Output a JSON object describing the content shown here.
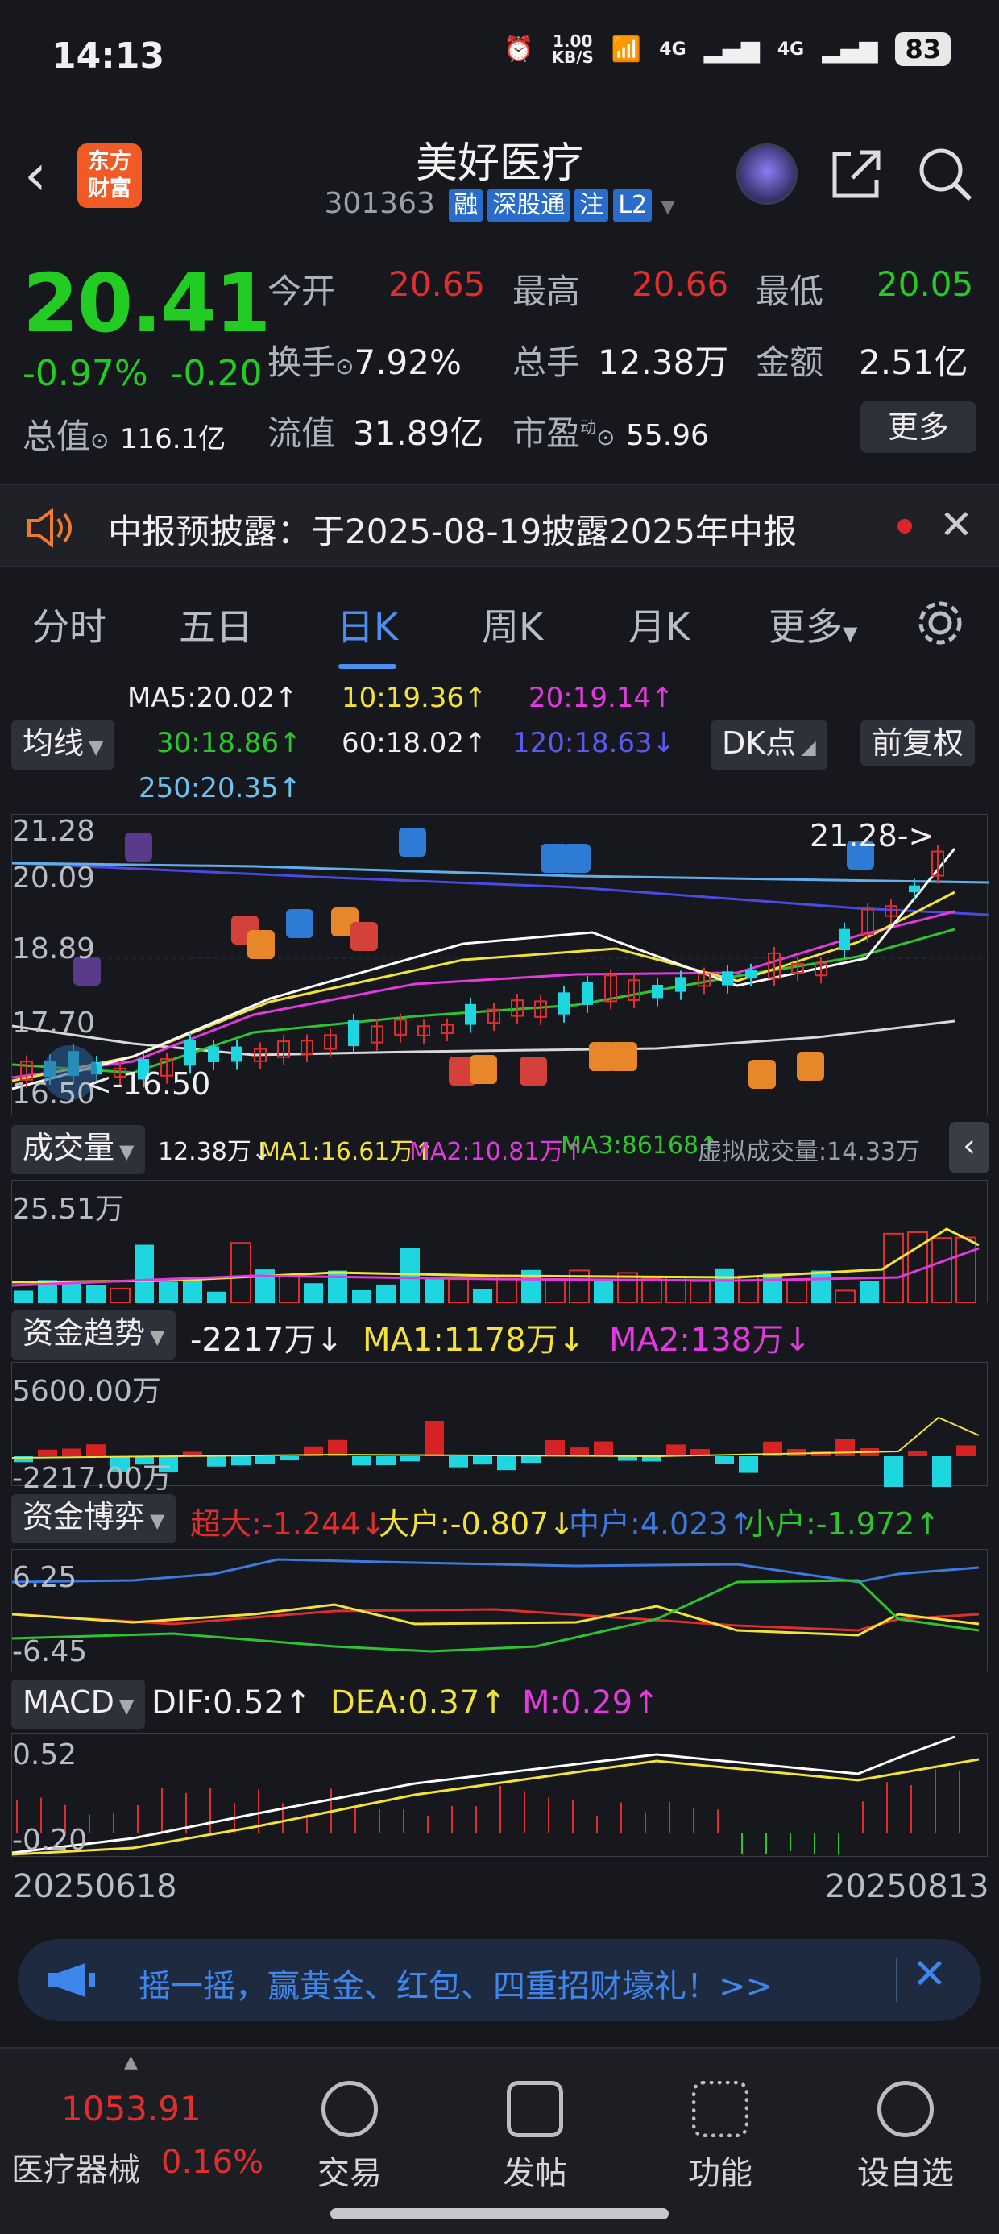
{
  "status_bar": {
    "time": "14:13",
    "net_speed": "1.00\nKB/S",
    "signal1": "4G",
    "signal2": "4G",
    "battery": "83"
  },
  "header": {
    "logo_text": "东方\n财富",
    "stock_name": "美好医疗",
    "code": "301363",
    "tags": [
      "融",
      "深股通",
      "注",
      "L2"
    ]
  },
  "quote": {
    "price": "20.41",
    "change_pct": "-0.97%",
    "change_amt": "-0.20",
    "open_label": "今开",
    "open": "20.65",
    "high_label": "最高",
    "high": "20.66",
    "low_label": "最低",
    "low": "20.05",
    "turnover_label": "换手",
    "turnover": "7.92%",
    "volume_label": "总手",
    "volume": "12.38万",
    "amount_label": "金额",
    "amount": "2.51亿",
    "mktcap_label": "总值",
    "mktcap": "116.1亿",
    "float_label": "流值",
    "float": "31.89亿",
    "pe_label": "市盈",
    "pe_sup": "动",
    "pe": "55.96",
    "more_button": "更多"
  },
  "notice": {
    "text": "中报预披露：于2025-08-19披露2025年中报"
  },
  "tabs": [
    "分时",
    "五日",
    "日K",
    "周K",
    "月K",
    "更多"
  ],
  "active_tab": "日K",
  "ma": {
    "selector": "均线",
    "ma5": "MA5:20.02↑",
    "ma10": "10:19.36↑",
    "ma20": "20:19.14↑",
    "ma30": "30:18.86↑",
    "ma60": "60:18.02↑",
    "ma120": "120:18.63↓",
    "ma250": "250:20.35↑",
    "dk_button": "DK点",
    "fq_button": "前复权"
  },
  "kline": {
    "axis": [
      "21.28",
      "20.09",
      "18.89",
      "17.70",
      "16.50"
    ],
    "high_mark": "21.28->",
    "low_mark": "<-16.50"
  },
  "volume": {
    "selector": "成交量",
    "v": "12.38万↓",
    "ma1": "MA1:16.61万↑",
    "ma2": "MA2:10.81万↑",
    "ma3": "MA3:86168↑",
    "virtual": "虚拟成交量:14.33万",
    "axis_top": "25.51万"
  },
  "fund": {
    "selector": "资金趋势",
    "v": "-2217万↓",
    "ma1": "MA1:1178万↓",
    "ma2": "MA2:138万↓",
    "axis_top": "5600.00万",
    "axis_bottom": "-2217.00万"
  },
  "game": {
    "selector": "资金博弈",
    "super": "超大:-1.244↓",
    "large": "大户:-0.807↓",
    "mid": "中户:4.023↑",
    "small": "小户:-1.972↑",
    "axis_top": "6.25",
    "axis_bottom": "-6.45"
  },
  "macd": {
    "selector": "MACD",
    "dif": "DIF:0.52↑",
    "dea": "DEA:0.37↑",
    "m": "M:0.29↑",
    "axis_top": "0.52",
    "axis_bottom": "-0.20"
  },
  "dates": {
    "start": "20250618",
    "end": "20250813"
  },
  "banner": {
    "text": "摇一摇，赢黄金、红包、四重招财壕礼！>>"
  },
  "bottom": {
    "index_value": "1053.91",
    "sector": "医疗器械",
    "sector_pct": "0.16%",
    "items": [
      "交易",
      "发帖",
      "功能",
      "设自选"
    ]
  },
  "colors": {
    "up": "#e02d2d",
    "down": "#22cc22",
    "accent": "#4d8ff0"
  }
}
